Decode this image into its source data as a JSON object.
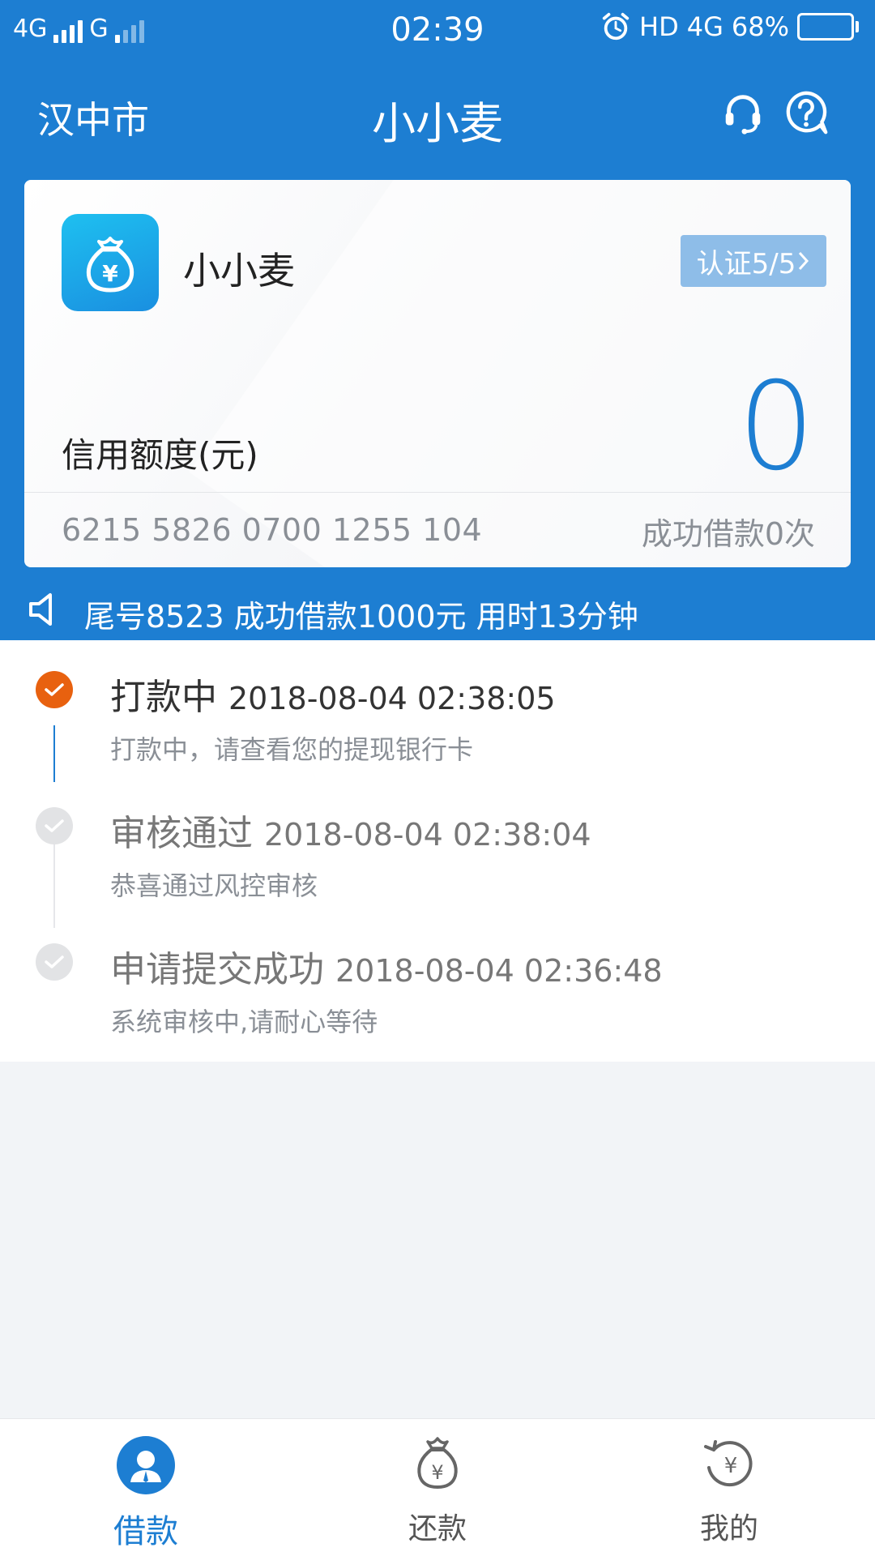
{
  "status_bar": {
    "network_left": "4G",
    "network_right": "G",
    "time": "02:39",
    "hd": "HD",
    "network_4g": "4G",
    "battery": "68%"
  },
  "header": {
    "city": "汉中市",
    "title": "小小麦"
  },
  "card": {
    "app_name": "小小麦",
    "cert_label": "认证5/5",
    "credit_label": "信用额度(元)",
    "credit_value": "0",
    "card_number": "6215 5826 0700 1255 104",
    "loan_count": "成功借款0次"
  },
  "notice": {
    "text": "尾号8523 成功借款1000元 用时13分钟"
  },
  "timeline": [
    {
      "title": "打款中",
      "time": "2018-08-04 02:38:05",
      "desc": "打款中，请查看您的提现银行卡",
      "state": "active"
    },
    {
      "title": "审核通过",
      "time": "2018-08-04 02:38:04",
      "desc": "恭喜通过风控审核",
      "state": "done"
    },
    {
      "title": "申请提交成功",
      "time": "2018-08-04 02:36:48",
      "desc": "系统审核中,请耐心等待",
      "state": "done"
    }
  ],
  "nav": {
    "borrow": "借款",
    "repay": "还款",
    "mine": "我的"
  },
  "colors": {
    "primary": "#1d7ed2",
    "active_step": "#e8610f",
    "badge": "#8ebde8"
  }
}
